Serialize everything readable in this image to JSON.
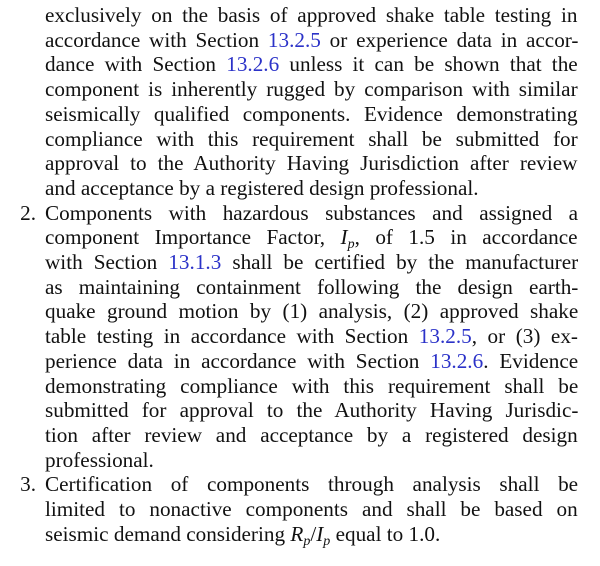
{
  "continuation_lines": [
    [
      "exclusively on the basis of approved shake table testing in"
    ],
    [
      "accordance with Section ",
      {
        "link": "13.2.5"
      },
      " or experience data in accor-"
    ],
    [
      "dance with Section ",
      {
        "link": "13.2.6"
      },
      " unless it can be shown that the"
    ],
    [
      "component is inherently rugged by comparison with similar"
    ],
    [
      "seismically qualified components. Evidence demonstrating"
    ],
    [
      "compliance with this requirement shall be submitted for"
    ],
    [
      "approval to the Authority Having Jurisdiction after review"
    ],
    [
      "and acceptance by a registered design professional."
    ]
  ],
  "items": [
    {
      "number": "2.",
      "lines": [
        [
          "Components with hazardous substances and assigned a"
        ],
        [
          "component Importance Factor, ",
          {
            "italic": "I",
            "sub": "p"
          },
          ", of 1.5 in accordance"
        ],
        [
          "with Section ",
          {
            "link": "13.1.3"
          },
          " shall be certified by the manufacturer"
        ],
        [
          "as maintaining containment following the design earth-"
        ],
        [
          "quake ground motion by (1) analysis, (2) approved shake"
        ],
        [
          "table testing in accordance with Section ",
          {
            "link": "13.2.5"
          },
          ", or (3) ex-"
        ],
        [
          "perience data in accordance with Section ",
          {
            "link": "13.2.6"
          },
          ". Evidence"
        ],
        [
          "demonstrating compliance with this requirement shall be"
        ],
        [
          "submitted for approval to the Authority Having Jurisdic-"
        ],
        [
          "tion after review and acceptance by a registered design"
        ],
        [
          "professional."
        ]
      ]
    },
    {
      "number": "3.",
      "lines": [
        [
          "Certification of components through analysis shall be"
        ],
        [
          "limited to nonactive components and shall be based on"
        ],
        [
          "seismic demand considering ",
          {
            "italic": "R",
            "sub": "p"
          },
          "/",
          {
            "italic": "I",
            "sub": "p"
          },
          " equal to 1.0."
        ]
      ]
    }
  ],
  "colors": {
    "text": "#111111",
    "link": "#2b32c8",
    "background": "#ffffff"
  }
}
